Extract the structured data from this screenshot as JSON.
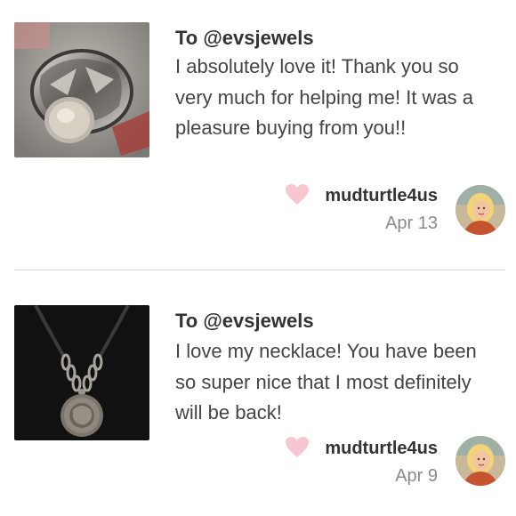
{
  "reviews": [
    {
      "recipient": "To @evsjewels",
      "message": "I absolutely love it! Thank you so very much for helping me! It was a pleasure buying from you!!",
      "username": "mudturtle4us",
      "date": "Apr 13",
      "item_icon": "ring-photo",
      "avatar_icon": "user-avatar-photo"
    },
    {
      "recipient": "To @evsjewels",
      "message": "I love my necklace! You have been so super nice that I most definitely will be back!",
      "username": "mudturtle4us",
      "date": "Apr 9",
      "item_icon": "necklace-photo",
      "avatar_icon": "user-avatar-photo"
    }
  ],
  "colors": {
    "heart": "#f8c6d0",
    "divider": "#d7d7d7",
    "date": "#8a8a8a",
    "text": "#333333"
  }
}
